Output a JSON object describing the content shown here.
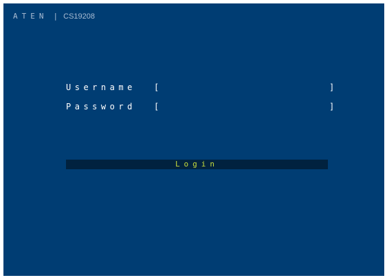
{
  "header": {
    "brand": "ATEN",
    "separator": "|",
    "model": "CS19208"
  },
  "form": {
    "username_label": "Username",
    "password_label": "Password",
    "bracket_open": "[",
    "bracket_close": "]",
    "username_value": "",
    "password_value": ""
  },
  "login_button": {
    "label": "Login"
  },
  "colors": {
    "background": "#003d73",
    "text": "#ffffff",
    "header_text": "#a9bcd3",
    "button_bg": "#01223f",
    "button_text": "#c8dc3b"
  }
}
